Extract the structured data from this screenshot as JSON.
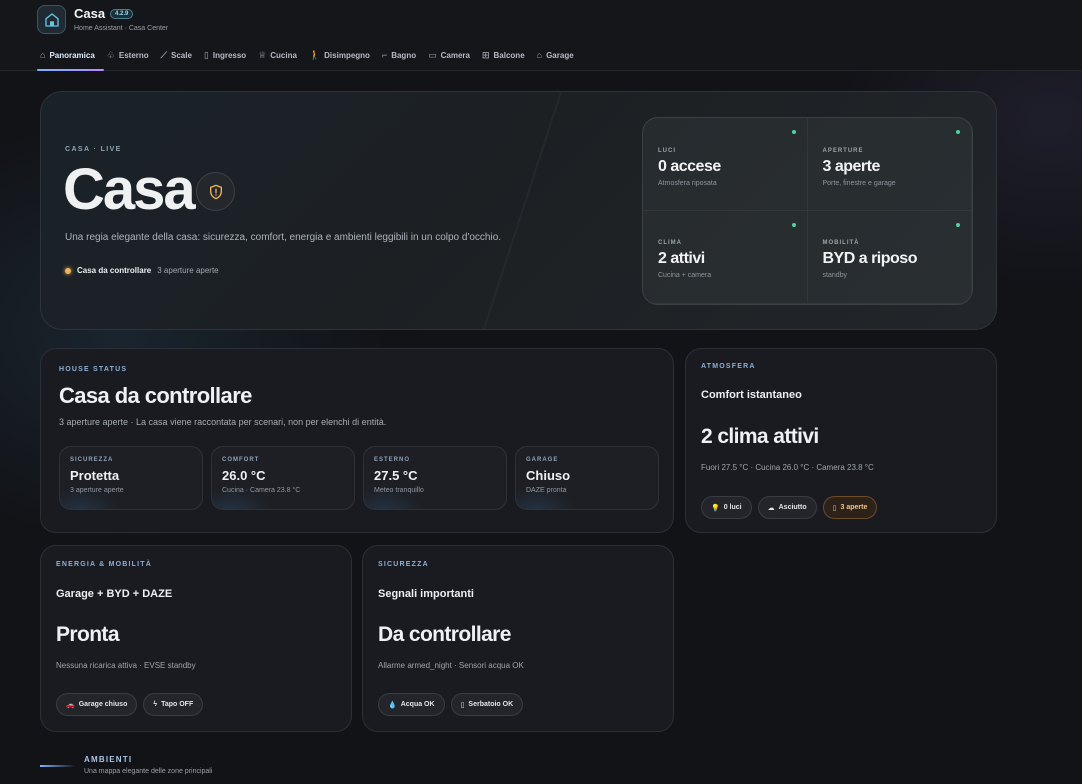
{
  "app": {
    "title": "Casa",
    "version": "4.2.9",
    "subtitle": "Home Assistant · Casa Center"
  },
  "tabs": [
    {
      "label": "Panoramica",
      "icon": "home-icon",
      "active": true
    },
    {
      "label": "Esterno",
      "icon": "tree-icon"
    },
    {
      "label": "Scale",
      "icon": "stairs-icon"
    },
    {
      "label": "Ingresso",
      "icon": "door-icon"
    },
    {
      "label": "Cucina",
      "icon": "chef-hat-icon"
    },
    {
      "label": "Disimpegno",
      "icon": "walk-icon"
    },
    {
      "label": "Bagno",
      "icon": "bathtub-icon"
    },
    {
      "label": "Camera",
      "icon": "bed-icon"
    },
    {
      "label": "Balcone",
      "icon": "balcony-icon"
    },
    {
      "label": "Garage",
      "icon": "garage-icon"
    }
  ],
  "hero": {
    "eyebrow": "CASA · LIVE",
    "title": "Casa",
    "description": "Una regia elegante della casa: sicurezza, comfort, energia e ambienti leggibili in un colpo d'occhio.",
    "status_strong": "Casa da controllare",
    "status_light": "3 aperture aperte",
    "stats": [
      {
        "label": "LUCI",
        "value": "0 accese",
        "sub": "Atmosfera riposata"
      },
      {
        "label": "APERTURE",
        "value": "3 aperte",
        "sub": "Porte, finestre e garage"
      },
      {
        "label": "CLIMA",
        "value": "2 attivi",
        "sub": "Cucina + camera"
      },
      {
        "label": "MOBILITÀ",
        "value": "BYD a riposo",
        "sub": "standby"
      }
    ]
  },
  "house_status": {
    "eyebrow": "HOUSE STATUS",
    "title": "Casa da controllare",
    "subtitle": "3 aperture aperte · La casa viene raccontata per scenari, non per elenchi di entità.",
    "tiles": [
      {
        "label": "SICUREZZA",
        "value": "Protetta",
        "sub": "3 aperture aperte"
      },
      {
        "label": "COMFORT",
        "value": "26.0 °C",
        "sub": "Cucina · Camera 23.8 °C"
      },
      {
        "label": "ESTERNO",
        "value": "27.5 °C",
        "sub": "Meteo tranquillo"
      },
      {
        "label": "GARAGE",
        "value": "Chiuso",
        "sub": "DAZE pronta"
      }
    ]
  },
  "atmosfera": {
    "eyebrow": "ATMOSFERA",
    "heading": "Comfort istantaneo",
    "value": "2 clima attivi",
    "sub": "Fuori 27.5 °C · Cucina 26.0 °C · Camera 23.8 °C",
    "chips": [
      {
        "label": "0 luci",
        "icon": "bulb-icon",
        "glyph": "💡"
      },
      {
        "label": "Asciutto",
        "icon": "cloud-icon",
        "glyph": "☁"
      },
      {
        "label": "3 aperte",
        "icon": "door-icon",
        "glyph": "▯"
      }
    ]
  },
  "energia": {
    "eyebrow": "ENERGIA & MOBILITÀ",
    "heading": "Garage + BYD + DAZE",
    "value": "Pronta",
    "sub": "Nessuna ricarica attiva · EVSE standby",
    "chips": [
      {
        "label": "Garage chiuso",
        "icon": "car-icon",
        "glyph": "🚗"
      },
      {
        "label": "Tapo OFF",
        "icon": "bolt-icon",
        "glyph": "ϟ"
      }
    ]
  },
  "sicurezza": {
    "eyebrow": "SICUREZZA",
    "heading": "Segnali importanti",
    "value": "Da controllare",
    "sub": "Allarme armed_night · Sensori acqua OK",
    "chips": [
      {
        "label": "Acqua OK",
        "icon": "water-drop-icon",
        "glyph": "💧"
      },
      {
        "label": "Serbatoio OK",
        "icon": "tank-icon",
        "glyph": "▯"
      }
    ]
  },
  "ambienti": {
    "title": "AMBIENTI",
    "subtitle": "Una mappa elegante delle zone principali"
  },
  "colors": {
    "accent": "#7fb3ff",
    "status_dot": "#4ed3a0",
    "warning": "#f1b35a"
  }
}
